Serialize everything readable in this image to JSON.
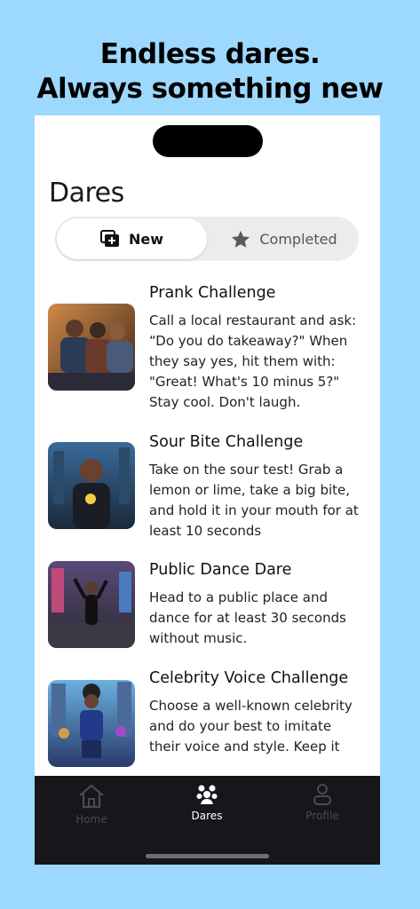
{
  "promo": {
    "line1": "Endless dares.",
    "line2": "Always something new"
  },
  "page": {
    "title": "Dares"
  },
  "segments": {
    "new_label": "New",
    "completed_label": "Completed",
    "selected": "New"
  },
  "dares": [
    {
      "title": "Prank Challenge",
      "lines": [
        "Call a local restaurant and ask:",
        "“Do you do takeaway?\" When",
        "they say yes, hit them with:",
        "\"Great! What's 10 minus 5?\"",
        "Stay cool. Don't laugh."
      ]
    },
    {
      "title": "Sour Bite Challenge",
      "lines": [
        "Take on the sour test! Grab a",
        "lemon or lime, take a big bite,",
        "and hold it in your mouth for at",
        "least 10 seconds"
      ]
    },
    {
      "title": "Public Dance Dare",
      "lines": [
        "Head to a public place and",
        "dance for at least 30 seconds",
        "without music."
      ]
    },
    {
      "title": "Celebrity Voice Challenge",
      "lines": [
        "Choose a well-known celebrity",
        "and do your best to imitate",
        "their voice and style. Keep it"
      ]
    }
  ],
  "tabbar": {
    "home_label": "Home",
    "dares_label": "Dares",
    "profile_label": "Profile",
    "active": "Dares"
  },
  "colors": {
    "background": "#9dd9ff",
    "tabbar": "#17161b",
    "segment_track": "#ececea"
  }
}
